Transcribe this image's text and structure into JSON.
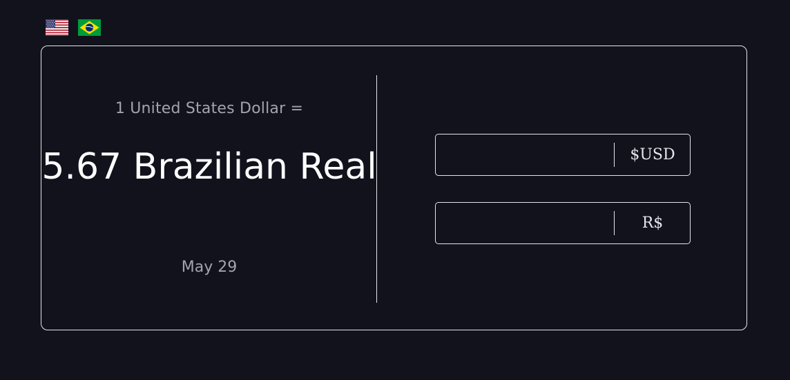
{
  "flags": [
    {
      "name": "us-flag-icon",
      "country": "United States"
    },
    {
      "name": "brazil-flag-icon",
      "country": "Brazil"
    }
  ],
  "converter": {
    "rate_label": "1 United States Dollar =",
    "rate_value": "5.67 Brazilian Real",
    "date": "May 29",
    "fields": {
      "usd": {
        "value": "",
        "placeholder": "",
        "unit": "$USD"
      },
      "brl": {
        "value": "",
        "placeholder": "",
        "unit": "R$"
      }
    }
  },
  "colors": {
    "background": "#12121c",
    "border": "#e6e6ec",
    "muted_text": "#a4a4ad",
    "primary_text": "#ffffff"
  }
}
